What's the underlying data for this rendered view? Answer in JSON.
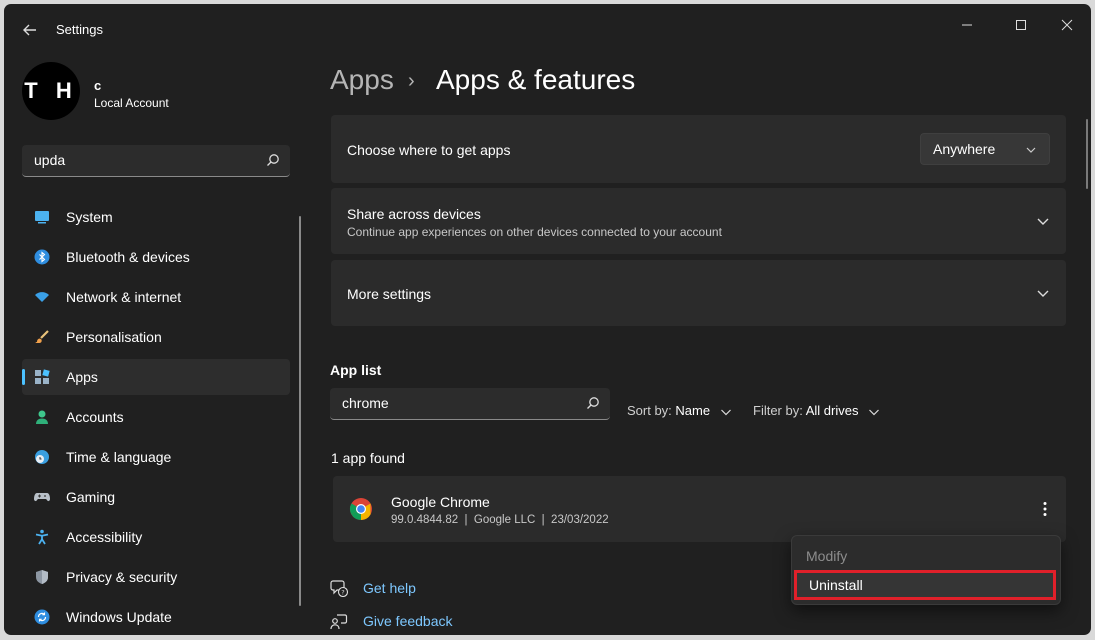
{
  "window": {
    "title": "Settings",
    "icons": [
      "back-arrow-icon",
      "minimize-icon",
      "maximize-icon",
      "close-icon"
    ]
  },
  "profile": {
    "initials": "T H",
    "name": "c",
    "account_type": "Local Account"
  },
  "sidebar": {
    "search_value": "upda",
    "items": [
      {
        "label": "System",
        "icon": "monitor-icon"
      },
      {
        "label": "Bluetooth & devices",
        "icon": "bluetooth-icon"
      },
      {
        "label": "Network & internet",
        "icon": "wifi-icon"
      },
      {
        "label": "Personalisation",
        "icon": "brush-icon"
      },
      {
        "label": "Apps",
        "icon": "apps-icon",
        "active": true
      },
      {
        "label": "Accounts",
        "icon": "person-icon"
      },
      {
        "label": "Time & language",
        "icon": "globe-clock-icon"
      },
      {
        "label": "Gaming",
        "icon": "gamepad-icon"
      },
      {
        "label": "Accessibility",
        "icon": "accessibility-icon"
      },
      {
        "label": "Privacy & security",
        "icon": "shield-icon"
      },
      {
        "label": "Windows Update",
        "icon": "update-icon"
      }
    ]
  },
  "breadcrumb": {
    "parent": "Apps",
    "separator": "›",
    "current": "Apps & features"
  },
  "cards": {
    "get_apps": {
      "title": "Choose where to get apps",
      "dropdown_value": "Anywhere"
    },
    "share": {
      "title": "Share across devices",
      "subtitle": "Continue app experiences on other devices connected to your account"
    },
    "more": {
      "title": "More settings"
    }
  },
  "app_list": {
    "heading": "App list",
    "search_value": "chrome",
    "sort_label": "Sort by:",
    "sort_value": "Name",
    "filter_label": "Filter by:",
    "filter_value": "All drives",
    "found_text": "1 app found",
    "apps": [
      {
        "name": "Google Chrome",
        "meta": "99.0.4844.82  |  Google LLC  |  23/03/2022",
        "icon": "chrome-icon"
      }
    ]
  },
  "context_menu": {
    "modify": "Modify",
    "uninstall": "Uninstall"
  },
  "help": {
    "get_help": "Get help",
    "give_feedback": "Give feedback"
  },
  "colors": {
    "background": "#202020",
    "card": "#2b2b2b",
    "accent": "#4cc2ff",
    "link": "#7ec8ff",
    "highlight_border": "#e0202a"
  }
}
